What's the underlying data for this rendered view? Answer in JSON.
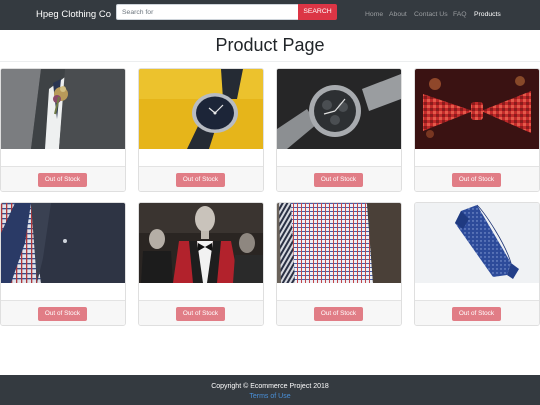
{
  "navbar": {
    "brand": "Hpeg Clothing Co",
    "search": {
      "placeholder": "Search for",
      "button_label": "SEARCH"
    },
    "links": [
      "Home",
      "About",
      "Contact Us",
      "FAQ",
      "Products"
    ],
    "active_link": "Products"
  },
  "page": {
    "title": "Product Page"
  },
  "products": [
    {
      "image": "suit-boutonniere-image",
      "button_label": "Out of Stock"
    },
    {
      "image": "watch-yellow-image",
      "button_label": "Out of Stock"
    },
    {
      "image": "chrome-watch-image",
      "button_label": "Out of Stock"
    },
    {
      "image": "red-bowtie-image",
      "button_label": "Out of Stock"
    },
    {
      "image": "plaid-shirt-jacket-image",
      "button_label": "Out of Stock"
    },
    {
      "image": "mannequins-image",
      "button_label": "Out of Stock"
    },
    {
      "image": "checked-shirt-image",
      "button_label": "Out of Stock"
    },
    {
      "image": "blue-tie-image",
      "button_label": "Out of Stock"
    }
  ],
  "footer": {
    "copyright": "Copyright © Ecommerce Project 2018",
    "terms_link": "Terms of Use"
  },
  "colors": {
    "navbar": "#343a40",
    "search_button": "#dc3545",
    "stock_button": "#e17d86",
    "link": "#4a90d9"
  }
}
